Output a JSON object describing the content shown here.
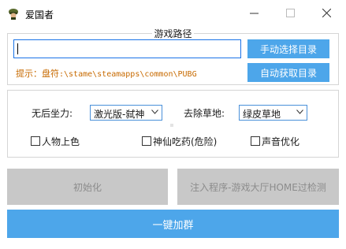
{
  "window": {
    "title": "爱国者",
    "icon": "soldier-helmet-icon",
    "controls": [
      "minimize-icon",
      "maximize-icon",
      "close-icon"
    ]
  },
  "path_group": {
    "legend": "游戏路径",
    "input_value": "",
    "hint_prefix": "提示：盘符",
    "hint_path": ":\\stame\\steamapps\\common\\PUBG",
    "manual_select_label": "手动选择目录",
    "auto_get_label": "自动获取目录"
  },
  "options_group": {
    "recoil_label": "无后坐力:",
    "recoil_value": "激光版-弑神",
    "grass_label": "去除草地:",
    "grass_value": "绿皮草地",
    "checkboxes": [
      {
        "label": "人物上色",
        "checked": false
      },
      {
        "label": "神仙吃药(危险)",
        "checked": false
      },
      {
        "label": "声音优化",
        "checked": false
      }
    ]
  },
  "actions": {
    "init_label": "初始化",
    "inject_label": "注入程序-游戏大厅HOME过检测",
    "join_group_label": "一键加群"
  },
  "colors": {
    "accent_blue": "#4da6ea",
    "hint_orange": "#c76a00",
    "disabled_gray": "#c8c8c8"
  }
}
